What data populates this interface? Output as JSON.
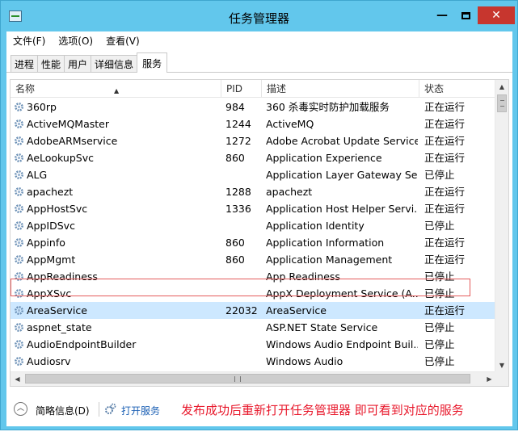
{
  "window": {
    "title": "任务管理器"
  },
  "menu": [
    {
      "label": "文件(F)"
    },
    {
      "label": "选项(O)"
    },
    {
      "label": "查看(V)"
    }
  ],
  "tabs": [
    {
      "label": "进程"
    },
    {
      "label": "性能"
    },
    {
      "label": "用户"
    },
    {
      "label": "详细信息"
    },
    {
      "label": "服务",
      "active": true
    }
  ],
  "table": {
    "columns": {
      "name": "名称",
      "pid": "PID",
      "desc": "描述",
      "status": "状态"
    },
    "rows": [
      {
        "name": "360rp",
        "pid": "984",
        "desc": "360 杀毒实时防护加载服务",
        "status": "正在运行"
      },
      {
        "name": "ActiveMQMaster",
        "pid": "1244",
        "desc": "ActiveMQ",
        "status": "正在运行"
      },
      {
        "name": "AdobeARMservice",
        "pid": "1272",
        "desc": "Adobe Acrobat Update Service",
        "status": "正在运行"
      },
      {
        "name": "AeLookupSvc",
        "pid": "860",
        "desc": "Application Experience",
        "status": "正在运行"
      },
      {
        "name": "ALG",
        "pid": "",
        "desc": "Application Layer Gateway Se...",
        "status": "已停止"
      },
      {
        "name": "apachezt",
        "pid": "1288",
        "desc": "apachezt",
        "status": "正在运行"
      },
      {
        "name": "AppHostSvc",
        "pid": "1336",
        "desc": "Application Host Helper Servi...",
        "status": "正在运行"
      },
      {
        "name": "AppIDSvc",
        "pid": "",
        "desc": "Application Identity",
        "status": "已停止"
      },
      {
        "name": "Appinfo",
        "pid": "860",
        "desc": "Application Information",
        "status": "正在运行"
      },
      {
        "name": "AppMgmt",
        "pid": "860",
        "desc": "Application Management",
        "status": "正在运行"
      },
      {
        "name": "AppReadiness",
        "pid": "",
        "desc": "App Readiness",
        "status": "已停止"
      },
      {
        "name": "AppXSvc",
        "pid": "",
        "desc": "AppX Deployment Service (A...",
        "status": "已停止"
      },
      {
        "name": "AreaService",
        "pid": "22032",
        "desc": "AreaService",
        "status": "正在运行",
        "selected": true
      },
      {
        "name": "aspnet_state",
        "pid": "",
        "desc": "ASP.NET State Service",
        "status": "已停止"
      },
      {
        "name": "AudioEndpointBuilder",
        "pid": "",
        "desc": "Windows Audio Endpoint Buil...",
        "status": "已停止"
      },
      {
        "name": "Audiosrv",
        "pid": "",
        "desc": "Windows Audio",
        "status": "已停止"
      }
    ]
  },
  "footer": {
    "fewer_details": "简略信息(D)",
    "open_services": "打开服务",
    "note": "发布成功后重新打开任务管理器 即可看到对应的服务"
  },
  "colors": {
    "titlebar": "#62c7ec",
    "close": "#c7362e",
    "selection": "#cde8ff",
    "note": "#e8192c",
    "link": "#1a5fb4"
  },
  "icons": [
    "app-icon",
    "minimize-icon",
    "maximize-icon",
    "close-icon",
    "service-gear-icon",
    "chevron-up-icon",
    "services-icon"
  ]
}
